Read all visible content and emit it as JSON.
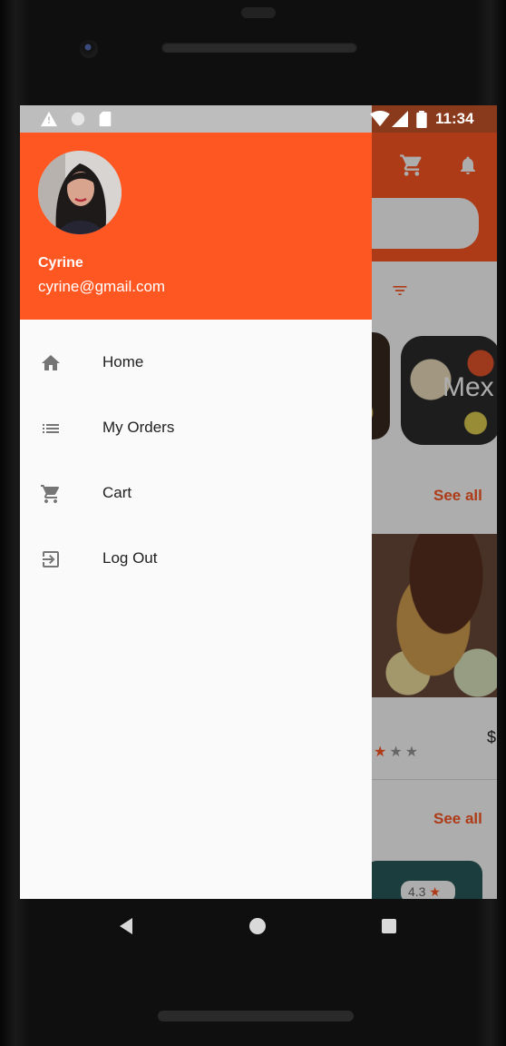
{
  "user": {
    "name": "Cyrine",
    "email": "cyrine@gmail.com"
  },
  "status_bar": {
    "time": "11:34"
  },
  "drawer_menu": [
    {
      "label": "Home",
      "icon": "home-icon"
    },
    {
      "label": "My Orders",
      "icon": "list-icon"
    },
    {
      "label": "Cart",
      "icon": "cart-icon"
    },
    {
      "label": "Log Out",
      "icon": "logout-icon"
    }
  ],
  "background_app": {
    "category_label": "Mex",
    "see_all_1": "See all",
    "see_all_2": "See all",
    "price_prefix": "$",
    "rating": "4.3"
  },
  "colors": {
    "accent": "#ff5722",
    "drawer_bg": "#fafafa",
    "text_primary": "#212121"
  }
}
